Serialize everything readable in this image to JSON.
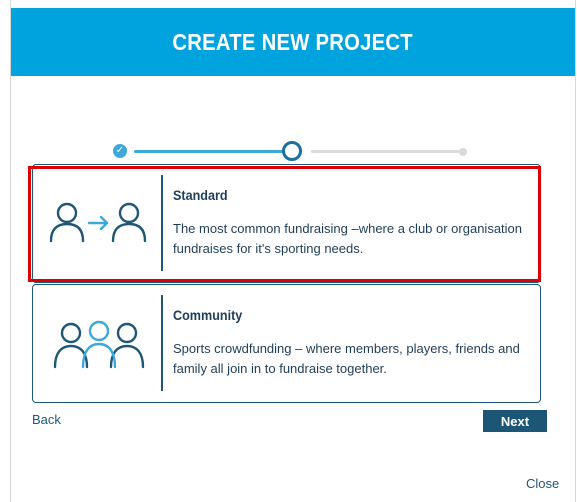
{
  "header": {
    "title": "CREATE NEW PROJECT"
  },
  "stepper": {
    "total_steps": 3,
    "current_step": 2,
    "completed_mark": "✓"
  },
  "options": [
    {
      "id": "standard",
      "title": "Standard",
      "description": "The most common fundraising –where a club or organisation fundraises for it's sporting needs.",
      "icon": "person-to-person-icon",
      "selected": true
    },
    {
      "id": "community",
      "title": "Community",
      "description": "Sports crowdfunding – where members, players, friends and family all join in to fundraise together.",
      "icon": "group-icon",
      "selected": false
    }
  ],
  "nav": {
    "back_label": "Back",
    "next_label": "Next",
    "close_label": "Close"
  },
  "colors": {
    "header_bg": "#00a3dd",
    "accent": "#3da9d8",
    "card_border": "#1f5776",
    "button_bg": "#1c5677",
    "selection_outline": "#dd0000"
  }
}
